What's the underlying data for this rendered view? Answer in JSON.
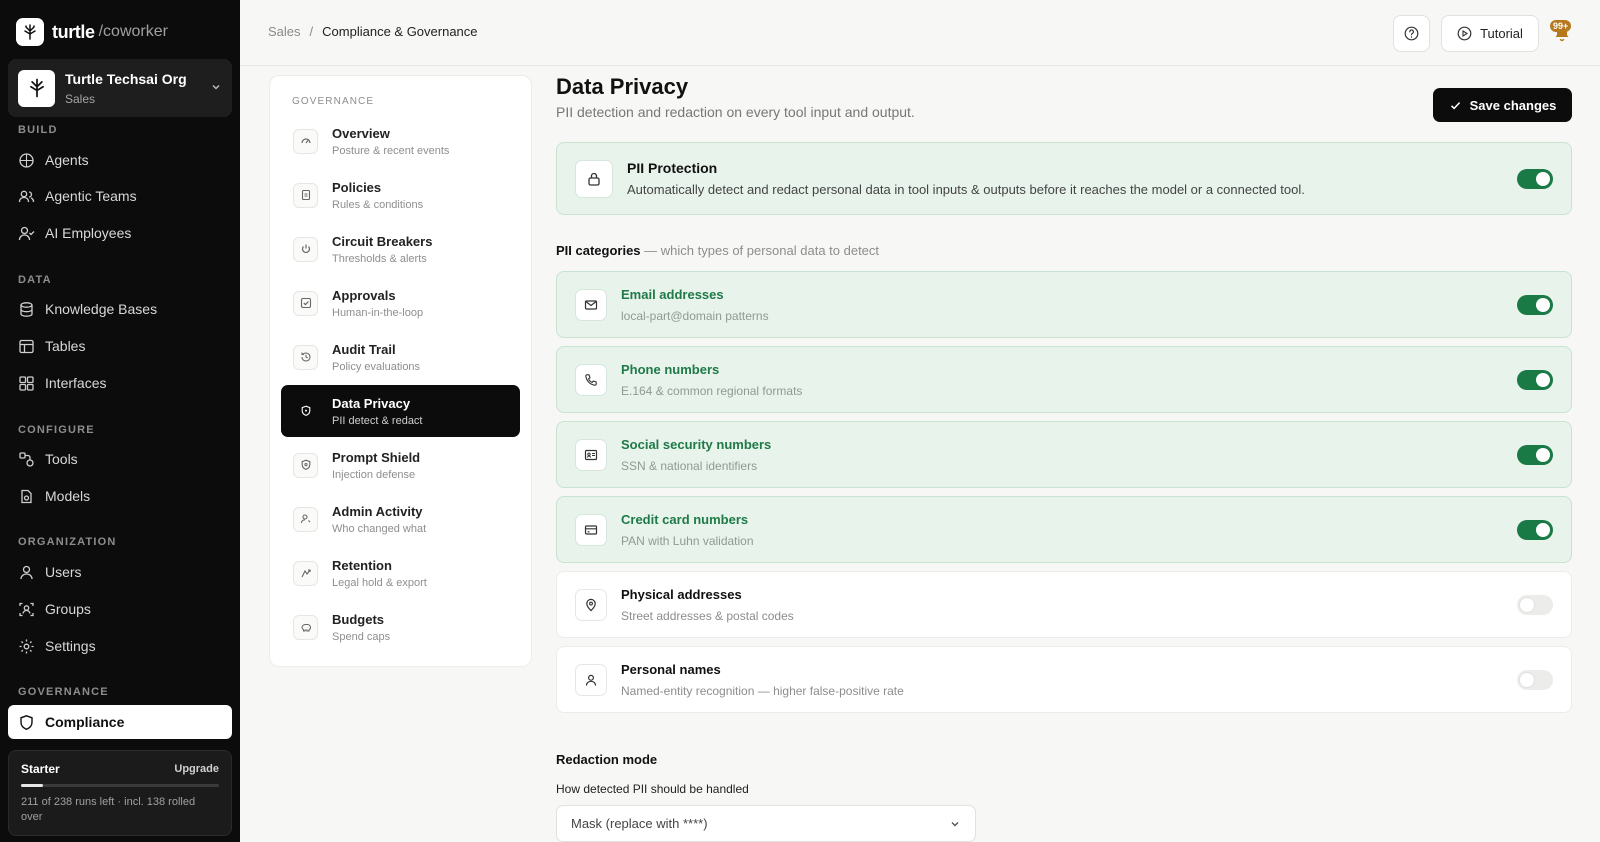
{
  "brand": {
    "name": "turtle",
    "sub": "/coworker"
  },
  "org": {
    "name": "Turtle Techsai Org",
    "sub": "Sales"
  },
  "sidebar": {
    "sections": {
      "build": "BUILD",
      "data": "DATA",
      "configure": "CONFIGURE",
      "organization": "ORGANIZATION",
      "governance": "GOVERNANCE"
    },
    "items": {
      "agents": "Agents",
      "agentic_teams": "Agentic Teams",
      "ai_employees": "AI Employees",
      "knowledge_bases": "Knowledge Bases",
      "tables": "Tables",
      "interfaces": "Interfaces",
      "tools": "Tools",
      "models": "Models",
      "users": "Users",
      "groups": "Groups",
      "settings": "Settings",
      "compliance": "Compliance"
    },
    "plan": {
      "name": "Starter",
      "upgrade": "Upgrade",
      "usage_fraction": 0.11,
      "text": "211 of 238 runs left · incl. 138 rolled over"
    }
  },
  "topbar": {
    "crumb_root": "Sales",
    "crumb_sep": "/",
    "crumb_current": "Compliance & Governance",
    "tutorial": "Tutorial",
    "badge": "99+"
  },
  "subnav": {
    "label": "GOVERNANCE",
    "items": [
      {
        "title": "Overview",
        "desc": "Posture & recent events"
      },
      {
        "title": "Policies",
        "desc": "Rules & conditions"
      },
      {
        "title": "Circuit Breakers",
        "desc": "Thresholds & alerts"
      },
      {
        "title": "Approvals",
        "desc": "Human-in-the-loop"
      },
      {
        "title": "Audit Trail",
        "desc": "Policy evaluations"
      },
      {
        "title": "Data Privacy",
        "desc": "PII detect & redact"
      },
      {
        "title": "Prompt Shield",
        "desc": "Injection defense"
      },
      {
        "title": "Admin Activity",
        "desc": "Who changed what"
      },
      {
        "title": "Retention",
        "desc": "Legal hold & export"
      },
      {
        "title": "Budgets",
        "desc": "Spend caps"
      }
    ]
  },
  "main": {
    "title": "Data Privacy",
    "subtitle": "PII detection and redaction on every tool input and output.",
    "save_label": "Save changes",
    "pii": {
      "title": "PII Protection",
      "desc": "Automatically detect and redact personal data in tool inputs & outputs before it reaches the model or a connected tool.",
      "enabled": true
    },
    "categories_title": "PII categories",
    "categories_hint": "— which types of personal data to detect",
    "categories": [
      {
        "title": "Email addresses",
        "desc": "local-part@domain patterns",
        "enabled": true
      },
      {
        "title": "Phone numbers",
        "desc": "E.164 & common regional formats",
        "enabled": true
      },
      {
        "title": "Social security numbers",
        "desc": "SSN & national identifiers",
        "enabled": true
      },
      {
        "title": "Credit card numbers",
        "desc": "PAN with Luhn validation",
        "enabled": true
      },
      {
        "title": "Physical addresses",
        "desc": "Street addresses & postal codes",
        "enabled": false
      },
      {
        "title": "Personal names",
        "desc": "Named-entity recognition — higher false-positive rate",
        "enabled": false
      }
    ],
    "redaction": {
      "title": "Redaction mode",
      "label": "How detected PII should be handled",
      "selected": "Mask (replace with ****)"
    }
  }
}
